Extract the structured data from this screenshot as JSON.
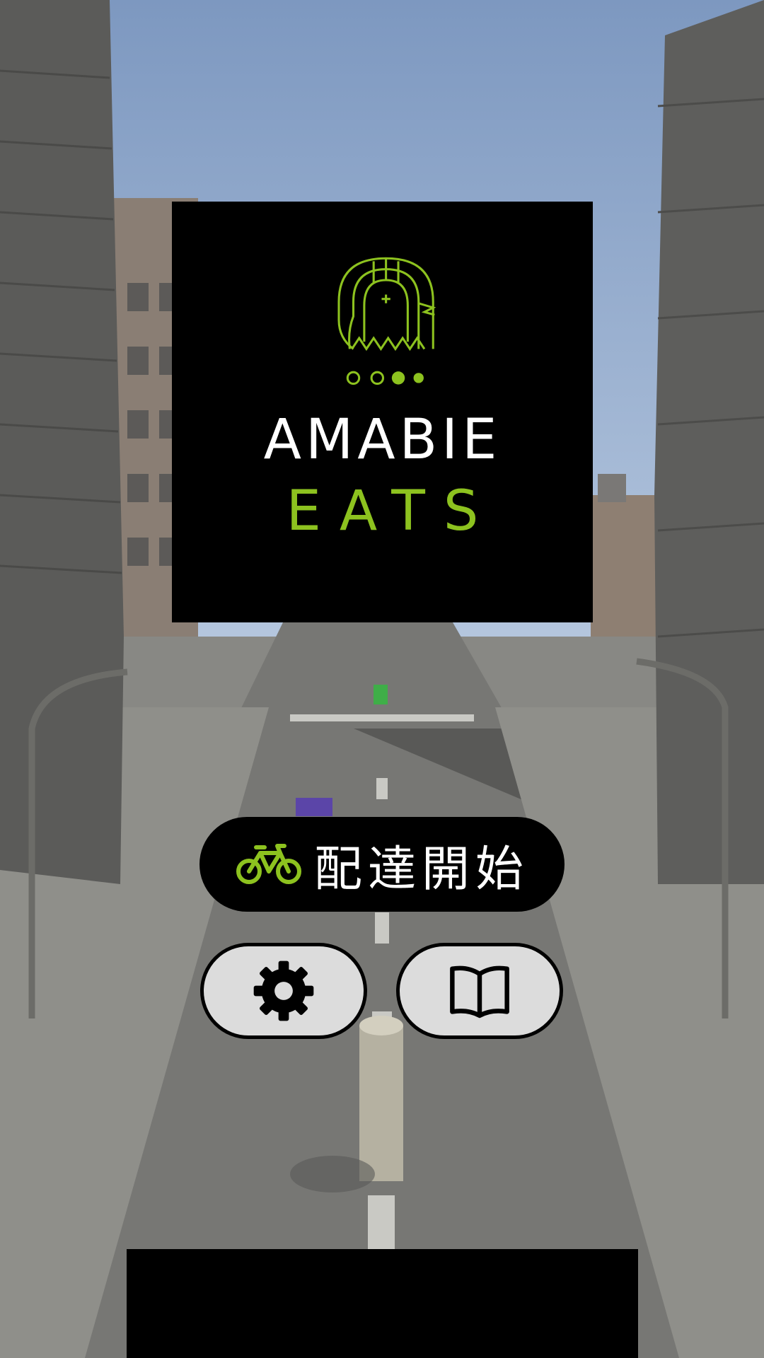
{
  "logo": {
    "line1": "AMABIE",
    "line2": "EATS",
    "icon": "amabie-mascot-icon"
  },
  "start_button": {
    "label": "配達開始",
    "icon": "bicycle-icon"
  },
  "settings_button": {
    "icon": "gear-icon"
  },
  "manual_button": {
    "icon": "open-book-icon"
  },
  "colors": {
    "accent": "#8dc21f",
    "panel": "#000000",
    "button_light": "#dcdcdc",
    "sky": "#8aa2c4"
  }
}
